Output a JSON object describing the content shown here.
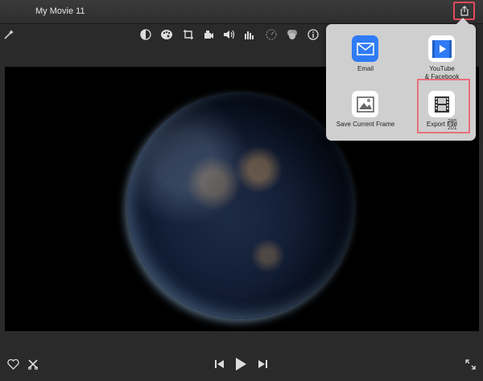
{
  "window": {
    "title": "My Movie 11"
  },
  "share_menu": {
    "items": [
      {
        "label": "Email",
        "icon": "mail-icon"
      },
      {
        "label": "YouTube\n& Facebook",
        "icon": "youtube-facebook-icon"
      },
      {
        "label": "Save Current Frame",
        "icon": "save-frame-icon"
      },
      {
        "label": "Export File",
        "icon": "film-icon"
      }
    ],
    "cursor_dims": {
      "w": "285",
      "h": "201"
    }
  },
  "colors": {
    "highlight": "#e24a5a",
    "mail_blue": "#2f7bf5"
  }
}
